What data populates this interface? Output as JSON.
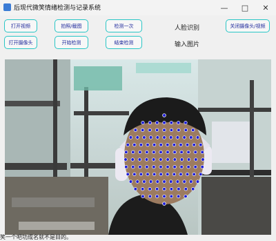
{
  "window": {
    "title": "后现代微笑情绪检测与记录系统",
    "minimize_glyph": "—",
    "maximize_glyph": "□",
    "close_glyph": "✕"
  },
  "toolbar": {
    "open_video": "打开视频",
    "snapshot": "拍照/截图",
    "detect_once": "检测一次",
    "face_recognition": "人脸识别",
    "close_camera_video": "关闭摄像头/视频",
    "open_camera": "打开摄像头",
    "start_detect": "开始检测",
    "end_detect": "结束检测",
    "input_image": "输入图片"
  },
  "icons": {
    "app": "app-icon",
    "video_scene": "camera-feed",
    "face_mesh": "face-landmark-mesh",
    "headphones": "headphones"
  },
  "colors": {
    "button_border": "#28c6c6",
    "button_text": "#1f2a9c",
    "landmark_fill": "#1e1ed8"
  },
  "status": {
    "text": "笑一个吧功成名就不是目的。"
  }
}
